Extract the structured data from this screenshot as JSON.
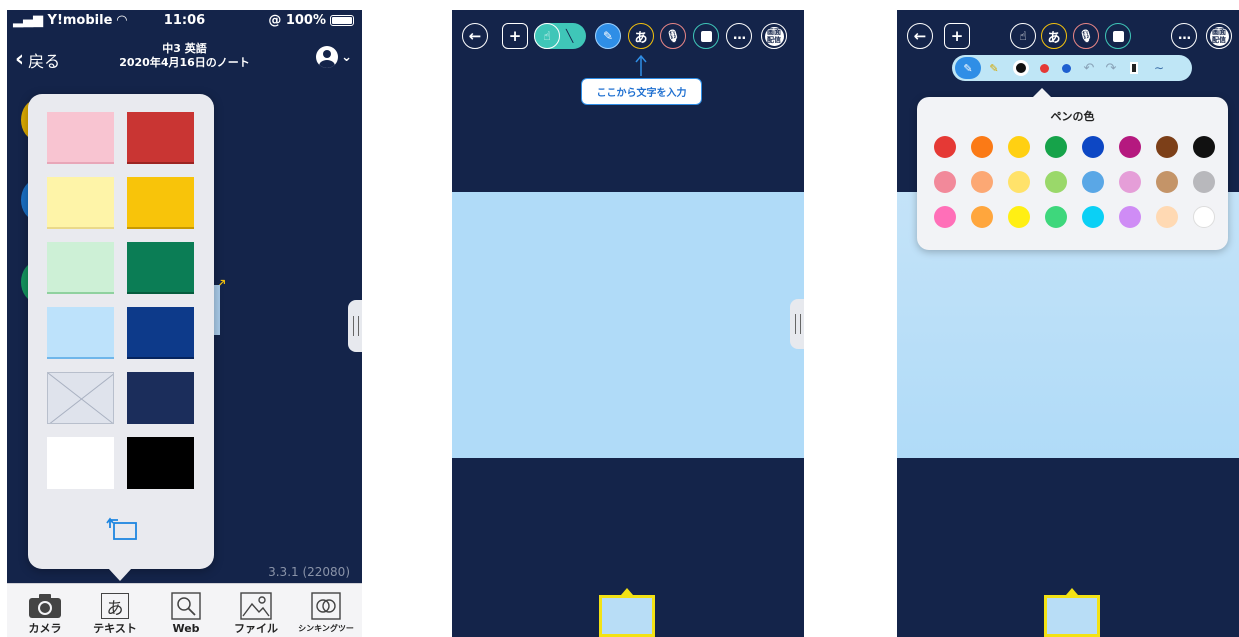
{
  "phone1": {
    "status": {
      "carrier": "Y!mobile",
      "time": "11:06",
      "battery": "@ 100%"
    },
    "nav": {
      "back_label": "戻る",
      "title_line1": "中3 英語",
      "title_line2": "2020年4月16日のノート"
    },
    "version": "3.3.1 (22080)",
    "card_colors": [
      "pink",
      "red",
      "light-yellow",
      "gold",
      "light-green",
      "green",
      "light-blue",
      "navy",
      "none",
      "dark-navy",
      "white",
      "black"
    ],
    "tabs": [
      {
        "label": "カメラ",
        "icon": "camera-icon"
      },
      {
        "label": "テキスト",
        "icon": "text-icon",
        "glyph": "あ"
      },
      {
        "label": "Web",
        "icon": "web-search-icon"
      },
      {
        "label": "ファイル",
        "icon": "image-file-icon"
      },
      {
        "label": "シンキングツール",
        "icon": "thinking-tool-icon"
      }
    ]
  },
  "phone2": {
    "toolbar": {
      "text_glyph": "あ",
      "more": "…",
      "haishin_line1": "画面",
      "haishin_line2": "配信"
    },
    "tooltip": "ここから文字を入力"
  },
  "phone3": {
    "toolbar": {
      "text_glyph": "あ",
      "more": "…",
      "haishin_line1": "画面",
      "haishin_line2": "配信"
    },
    "pen_popup_title": "ペンの色",
    "pen_colors": [
      "#e53935",
      "#fb7a16",
      "#ffd012",
      "#16a34a",
      "#0d47c4",
      "#b5197f",
      "#7c3f18",
      "#111111",
      "#f2899a",
      "#fca874",
      "#ffe26a",
      "#9ad86a",
      "#5aa7e6",
      "#e59ed8",
      "#c49468",
      "#b8b8bc",
      "#ff6fb8",
      "#ffa63d",
      "#ffef14",
      "#3ed77c",
      "#0bd0f5",
      "#cf8cf5",
      "#ffd9b3",
      "#ffffff"
    ]
  }
}
